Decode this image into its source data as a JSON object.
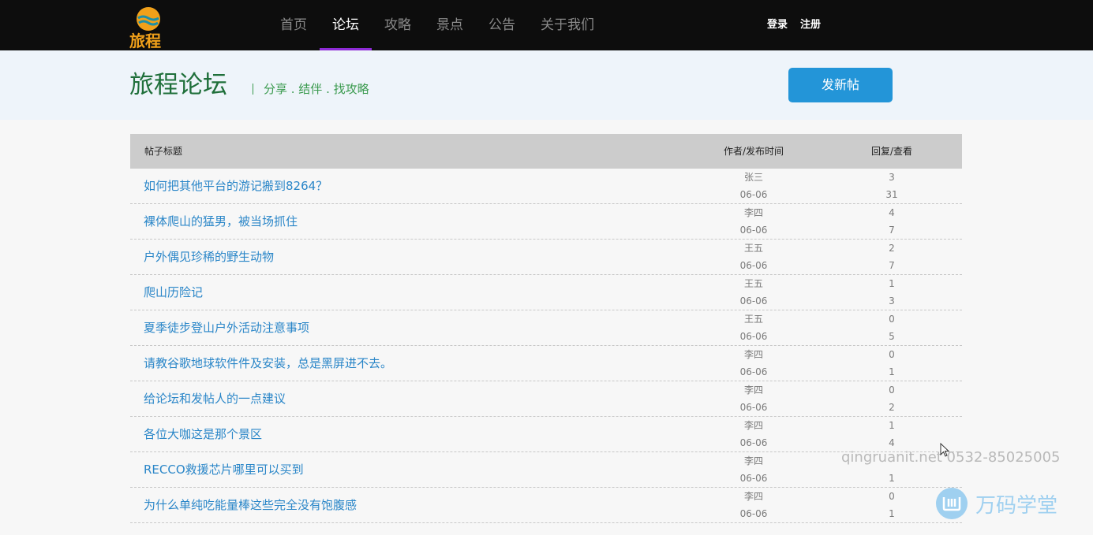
{
  "nav": {
    "logo_text": "旅程",
    "items": [
      {
        "label": "首页",
        "active": false
      },
      {
        "label": "论坛",
        "active": true
      },
      {
        "label": "攻略",
        "active": false
      },
      {
        "label": "景点",
        "active": false
      },
      {
        "label": "公告",
        "active": false
      },
      {
        "label": "关于我们",
        "active": false
      }
    ],
    "login": "登录",
    "register": "注册"
  },
  "banner": {
    "title": "旅程论坛",
    "subtitle": "分享 . 结伴 . 找攻略",
    "new_post": "发新帖"
  },
  "table": {
    "headers": {
      "title": "帖子标题",
      "author": "作者/发布时间",
      "stats": "回复/查看"
    },
    "rows": [
      {
        "title": "如何把其他平台的游记搬到8264？",
        "author": "张三",
        "date": "06-06",
        "replies": "3",
        "views": "31"
      },
      {
        "title": "裸体爬山的猛男，被当场抓住",
        "author": "李四",
        "date": "06-06",
        "replies": "4",
        "views": "7"
      },
      {
        "title": "户外偶见珍稀的野生动物",
        "author": "王五",
        "date": "06-06",
        "replies": "2",
        "views": "7"
      },
      {
        "title": "爬山历险记",
        "author": "王五",
        "date": "06-06",
        "replies": "1",
        "views": "3"
      },
      {
        "title": "夏季徒步登山户外活动注意事项",
        "author": "王五",
        "date": "06-06",
        "replies": "0",
        "views": "5"
      },
      {
        "title": "请教谷歌地球软件件及安装，总是黑屏进不去。",
        "author": "李四",
        "date": "06-06",
        "replies": "0",
        "views": "1"
      },
      {
        "title": "给论坛和发帖人的一点建议",
        "author": "李四",
        "date": "06-06",
        "replies": "0",
        "views": "2"
      },
      {
        "title": "各位大咖这是那个景区",
        "author": "李四",
        "date": "06-06",
        "replies": "1",
        "views": "4"
      },
      {
        "title": "RECCO救援芯片哪里可以买到",
        "author": "李四",
        "date": "06-06",
        "replies": "",
        "views": "1"
      },
      {
        "title": "为什么单纯吃能量棒这些完全没有饱腹感",
        "author": "李四",
        "date": "06-06",
        "replies": "0",
        "views": "1"
      }
    ]
  },
  "watermark": {
    "contact": "qingruanit.net 0532-85025005",
    "brand": "万码学堂"
  },
  "colors": {
    "topbar": "#0d0d0d",
    "nav_active_underline": "#8e2bd6",
    "banner_bg": "#eef4fa",
    "title_green": "#1f6f3a",
    "button_blue": "#2395d8",
    "link_blue": "#2a86c8"
  }
}
